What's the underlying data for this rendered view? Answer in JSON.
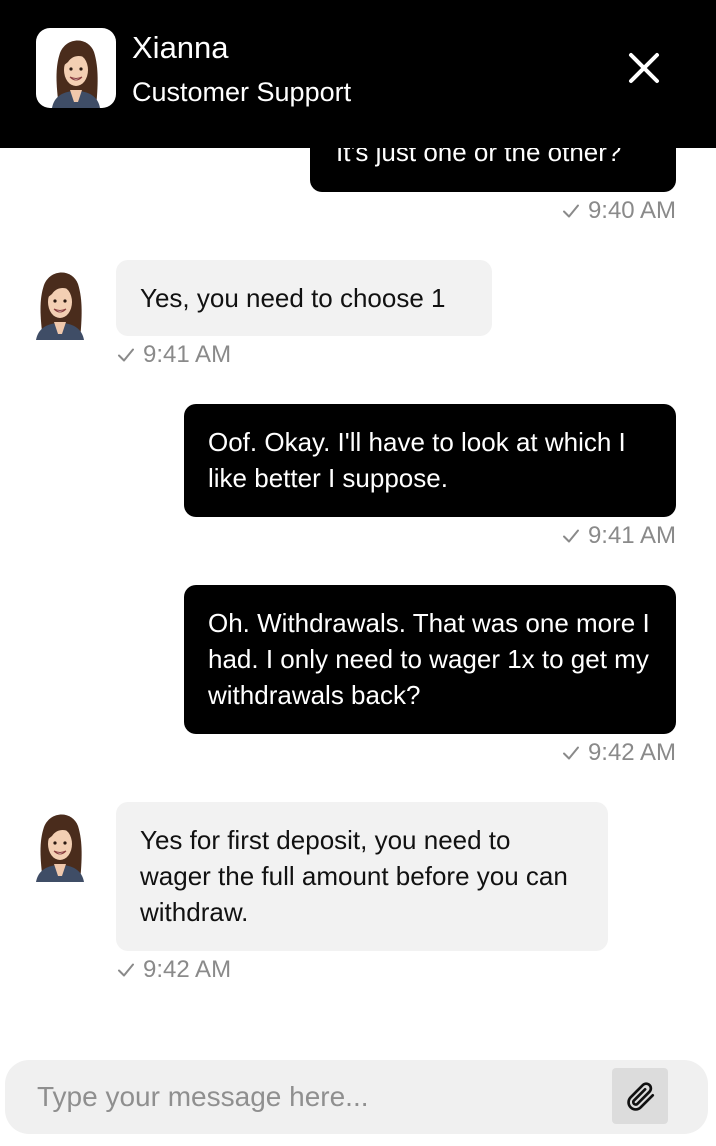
{
  "header": {
    "name": "Xianna",
    "subtitle": "Customer Support",
    "close_icon": "close-icon",
    "avatar_icon": "agent-portrait"
  },
  "messages": [
    {
      "sender": "user",
      "text": "It's just one or the other?",
      "time": "9:40 AM",
      "status_icon": "check-icon"
    },
    {
      "sender": "agent",
      "text": "Yes, you need to choose 1",
      "time": "9:41 AM",
      "status_icon": "check-icon"
    },
    {
      "sender": "user",
      "text": "Oof. Okay. I'll have to look at which I like better I suppose.",
      "time": "9:41 AM",
      "status_icon": "check-icon"
    },
    {
      "sender": "user",
      "text": "Oh. Withdrawals. That was one more I had. I only need to wager 1x to get my withdrawals back?",
      "time": "9:42 AM",
      "status_icon": "check-icon"
    },
    {
      "sender": "agent",
      "text": "Yes for first deposit, you need to wager the full amount before you can withdraw.",
      "time": "9:42 AM",
      "status_icon": "check-icon"
    }
  ],
  "composer": {
    "placeholder": "Type your message here...",
    "value": "",
    "attach_icon": "paperclip-icon"
  },
  "colors": {
    "header_bg": "#000000",
    "outgoing_bubble": "#000000",
    "incoming_bubble": "#f2f2f2",
    "timestamp": "#8a8a8a"
  }
}
